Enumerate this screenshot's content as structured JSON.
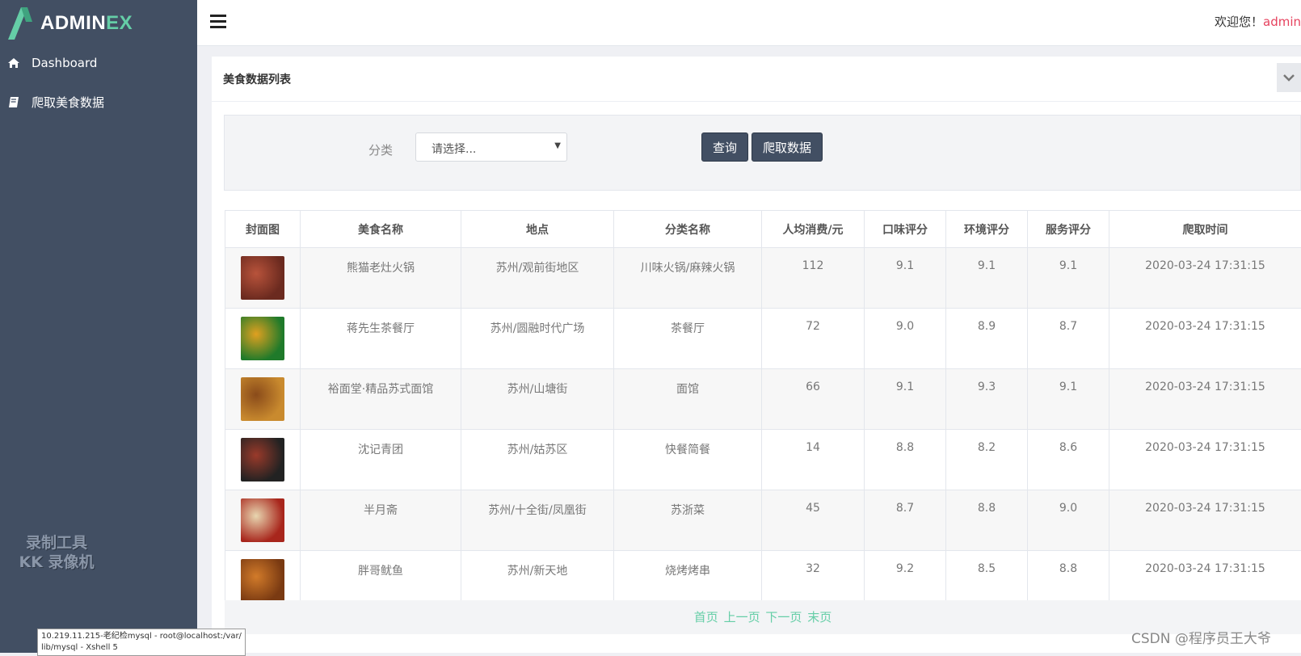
{
  "app": {
    "brand_main": "ADMIN",
    "brand_accent": "EX",
    "welcome_prefix": "欢迎您！",
    "username": "admin",
    "colors": {
      "sidebar": "#424f63",
      "accent": "#65cea7",
      "user": "#e6425e"
    }
  },
  "sidebar": {
    "items": [
      {
        "label": "Dashboard",
        "icon": "home-icon"
      },
      {
        "label": "爬取美食数据",
        "icon": "book-icon"
      }
    ],
    "recorder_watermark": [
      "录制工具",
      "KK 录像机"
    ]
  },
  "panel": {
    "title": "美食数据列表"
  },
  "filter": {
    "category_label": "分类",
    "select_value": "请选择...",
    "query_button": "查询",
    "crawl_button": "爬取数据"
  },
  "table": {
    "headers": [
      "封面图",
      "美食名称",
      "地点",
      "分类名称",
      "人均消费/元",
      "口味评分",
      "环境评分",
      "服务评分",
      "爬取时间"
    ],
    "rows": [
      {
        "name": "熊猫老灶火锅",
        "location": "苏州/观前街地区",
        "category": "川味火锅/麻辣火锅",
        "price": "112",
        "taste": "9.1",
        "env": "9.1",
        "service": "9.1",
        "time": "2020-03-24 17:31:15",
        "thumb_colors": [
          "#6b2a1f",
          "#b8533b"
        ]
      },
      {
        "name": "蒋先生茶餐厅",
        "location": "苏州/圆融时代广场",
        "category": "茶餐厅",
        "price": "72",
        "taste": "9.0",
        "env": "8.9",
        "service": "8.7",
        "time": "2020-03-24 17:31:15",
        "thumb_colors": [
          "#1f7a2a",
          "#e0a020"
        ]
      },
      {
        "name": "裕面堂·精品苏式面馆",
        "location": "苏州/山塘街",
        "category": "面馆",
        "price": "66",
        "taste": "9.1",
        "env": "9.3",
        "service": "9.1",
        "time": "2020-03-24 17:31:15",
        "thumb_colors": [
          "#c98a2e",
          "#8a4b1a"
        ]
      },
      {
        "name": "沈记青团",
        "location": "苏州/姑苏区",
        "category": "快餐简餐",
        "price": "14",
        "taste": "8.8",
        "env": "8.2",
        "service": "8.6",
        "time": "2020-03-24 17:31:15",
        "thumb_colors": [
          "#222222",
          "#9a3a2a"
        ]
      },
      {
        "name": "半月斋",
        "location": "苏州/十全街/凤凰街",
        "category": "苏浙菜",
        "price": "45",
        "taste": "8.7",
        "env": "8.8",
        "service": "9.0",
        "time": "2020-03-24 17:31:15",
        "thumb_colors": [
          "#a8261c",
          "#e8d6b0"
        ]
      },
      {
        "name": "胖哥鱿鱼",
        "location": "苏州/新天地",
        "category": "烧烤烤串",
        "price": "32",
        "taste": "9.2",
        "env": "8.5",
        "service": "8.8",
        "time": "2020-03-24 17:31:15",
        "thumb_colors": [
          "#7a3a12",
          "#d27b2a"
        ]
      }
    ]
  },
  "pager": {
    "first": "首页",
    "prev": "上一页",
    "next": "下一页",
    "last": "末页"
  },
  "overlay": {
    "xshell_line1": "10.219.11.215-老纪检mysql - root@localhost:/var/",
    "xshell_line2": "lib/mysql - Xshell 5",
    "csdn": "CSDN @程序员王大爷"
  }
}
